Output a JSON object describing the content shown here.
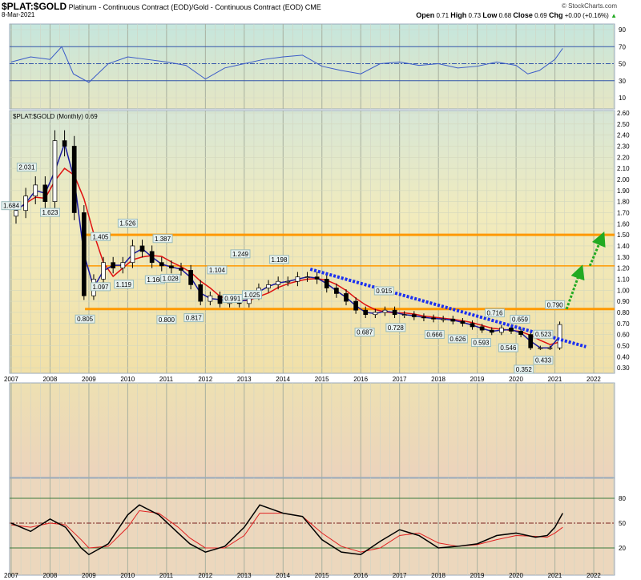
{
  "header": {
    "symbol": "$PLAT:$GOLD",
    "description": "Platinum - Continuous Contract (EOD)/Gold - Continuous Contract (EOD)",
    "exchange": "CME",
    "date": "8-Mar-2021",
    "brand": "© StockCharts.com",
    "open_label": "Open",
    "open": "0.71",
    "high_label": "High",
    "high": "0.73",
    "low_label": "Low",
    "low": "0.68",
    "close_label": "Close",
    "close": "0.69",
    "chg_label": "Chg",
    "chg": "+0.00 (+0.16%)"
  },
  "colors": {
    "up": "#ffffff",
    "down": "#000000",
    "ma_short": "#1a1aa0",
    "ma_long": "#e01010",
    "trend": "#1a2ff0",
    "arrow": "#22aa22",
    "level": "#ff9900"
  },
  "chart_data": [
    {
      "type": "line",
      "name": "RSI",
      "yticks": [
        90,
        70,
        50,
        30,
        10
      ],
      "ylim": [
        0,
        100
      ],
      "levels": [
        70,
        50,
        30
      ],
      "x": [
        2007,
        2007.5,
        2008,
        2008.3,
        2008.6,
        2009,
        2009.5,
        2010,
        2010.5,
        2011,
        2011.5,
        2012,
        2012.5,
        2013,
        2013.5,
        2014,
        2014.5,
        2015,
        2015.5,
        2016,
        2016.5,
        2017,
        2017.5,
        2018,
        2018.5,
        2019,
        2019.5,
        2020,
        2020.3,
        2020.6,
        2021,
        2021.2
      ],
      "values": [
        52,
        58,
        55,
        70,
        38,
        28,
        50,
        58,
        55,
        52,
        48,
        32,
        45,
        50,
        55,
        58,
        60,
        47,
        42,
        38,
        50,
        52,
        48,
        50,
        45,
        47,
        52,
        48,
        38,
        42,
        55,
        68
      ]
    },
    {
      "type": "candlestick",
      "name": "$PLAT:$GOLD (Monthly) 0.69",
      "title": "$PLAT:$GOLD (Monthly) 0.69",
      "ylim": [
        0.25,
        2.65
      ],
      "yticks": [
        "2.60",
        "2.50",
        "2.40",
        "2.30",
        "2.20",
        "2.10",
        "2.00",
        "1.90",
        "1.80",
        "1.70",
        "1.60",
        "1.50",
        "1.40",
        "1.30",
        "1.20",
        "1.10",
        "1.00",
        "0.90",
        "0.80",
        "0.70",
        "0.60",
        "0.50",
        "0.40",
        "0.30"
      ],
      "xticks": [
        "2007",
        "2008",
        "2009",
        "2010",
        "2011",
        "2012",
        "2013",
        "2014",
        "2015",
        "2016",
        "2017",
        "2018",
        "2019",
        "2020",
        "2021",
        "2022"
      ],
      "x_start": 2007,
      "x_step": 0.25,
      "closes": [
        1.72,
        1.85,
        1.95,
        1.8,
        2.35,
        2.3,
        1.7,
        0.95,
        1.1,
        1.25,
        1.2,
        1.25,
        1.4,
        1.35,
        1.25,
        1.22,
        1.2,
        1.18,
        1.05,
        0.9,
        0.95,
        0.88,
        0.92,
        0.88,
        0.95,
        1.02,
        1.05,
        1.08,
        1.08,
        1.12,
        1.12,
        1.1,
        1.02,
        0.97,
        0.9,
        0.82,
        0.78,
        0.8,
        0.82,
        0.78,
        0.78,
        0.76,
        0.75,
        0.74,
        0.74,
        0.72,
        0.7,
        0.67,
        0.64,
        0.62,
        0.66,
        0.63,
        0.6,
        0.48,
        0.48,
        0.48,
        0.69
      ],
      "annotations": [
        {
          "x": 2007,
          "y": 1.684,
          "label": "1.684"
        },
        {
          "x": 2007.4,
          "y": 2.031,
          "label": "2.031"
        },
        {
          "x": 2008,
          "y": 1.623,
          "label": "1.623"
        },
        {
          "x": 2008.9,
          "y": 0.805,
          "label": "0.805"
        },
        {
          "x": 2009.3,
          "y": 1.405,
          "label": "1.405"
        },
        {
          "x": 2009.3,
          "y": 1.097,
          "label": "1.097"
        },
        {
          "x": 2009.9,
          "y": 1.119,
          "label": "1.119"
        },
        {
          "x": 2010.0,
          "y": 1.526,
          "label": "1.526"
        },
        {
          "x": 2010.9,
          "y": 1.387,
          "label": "1.387"
        },
        {
          "x": 2010.7,
          "y": 1.16,
          "label": "1.160"
        },
        {
          "x": 2011.0,
          "y": 0.8,
          "label": "0.800"
        },
        {
          "x": 2011.1,
          "y": 1.028,
          "label": "1.028"
        },
        {
          "x": 2011.7,
          "y": 0.817,
          "label": "0.817"
        },
        {
          "x": 2012.3,
          "y": 1.104,
          "label": "1.104"
        },
        {
          "x": 2012.9,
          "y": 1.249,
          "label": "1.249"
        },
        {
          "x": 2012.7,
          "y": 0.991,
          "label": "0.991"
        },
        {
          "x": 2013.2,
          "y": 1.025,
          "label": "1.025"
        },
        {
          "x": 2013.9,
          "y": 1.198,
          "label": "1.198"
        },
        {
          "x": 2016.1,
          "y": 0.687,
          "label": "0.687"
        },
        {
          "x": 2016.6,
          "y": 0.915,
          "label": "0.915"
        },
        {
          "x": 2016.9,
          "y": 0.728,
          "label": "0.728"
        },
        {
          "x": 2017.9,
          "y": 0.666,
          "label": "0.666"
        },
        {
          "x": 2018.5,
          "y": 0.626,
          "label": "0.626"
        },
        {
          "x": 2019.1,
          "y": 0.593,
          "label": "0.593"
        },
        {
          "x": 2019.8,
          "y": 0.546,
          "label": "0.546"
        },
        {
          "x": 2019.45,
          "y": 0.716,
          "label": "0.716"
        },
        {
          "x": 2020.1,
          "y": 0.659,
          "label": "0.659"
        },
        {
          "x": 2020.2,
          "y": 0.352,
          "label": "0.352"
        },
        {
          "x": 2020.7,
          "y": 0.433,
          "label": "0.433"
        },
        {
          "x": 2020.7,
          "y": 0.523,
          "label": "0.523"
        },
        {
          "x": 2021.0,
          "y": 0.79,
          "label": "0.790"
        }
      ],
      "levels": [
        1.5,
        1.22,
        0.83
      ],
      "trendline": [
        [
          2014.7,
          1.19
        ],
        [
          2021.8,
          0.49
        ]
      ],
      "arrows": [
        [
          [
            2021.3,
            0.83
          ],
          [
            2021.65,
            1.17
          ]
        ],
        [
          [
            2021.9,
            1.22
          ],
          [
            2022.2,
            1.47
          ]
        ]
      ]
    },
    {
      "type": "line",
      "name": "Stochastic",
      "yticks": [
        80,
        50,
        20
      ],
      "ylim": [
        0,
        100
      ],
      "x": [
        2007,
        2007.5,
        2008,
        2008.4,
        2008.8,
        2009,
        2009.5,
        2010,
        2010.3,
        2010.8,
        2011.3,
        2011.6,
        2012,
        2012.5,
        2013,
        2013.4,
        2014,
        2014.5,
        2015,
        2015.5,
        2016,
        2016.5,
        2017,
        2017.5,
        2018,
        2018.5,
        2019,
        2019.5,
        2020,
        2020.5,
        2020.8,
        2021,
        2021.2
      ],
      "k": [
        50,
        40,
        55,
        45,
        20,
        12,
        25,
        60,
        72,
        60,
        38,
        25,
        15,
        22,
        45,
        72,
        62,
        58,
        30,
        15,
        12,
        28,
        42,
        35,
        20,
        22,
        25,
        35,
        38,
        33,
        35,
        45,
        62
      ],
      "d": [
        48,
        45,
        50,
        48,
        30,
        20,
        22,
        45,
        65,
        62,
        45,
        32,
        20,
        20,
        35,
        62,
        62,
        58,
        38,
        22,
        15,
        20,
        35,
        38,
        26,
        22,
        24,
        30,
        35,
        34,
        33,
        38,
        45
      ]
    }
  ]
}
